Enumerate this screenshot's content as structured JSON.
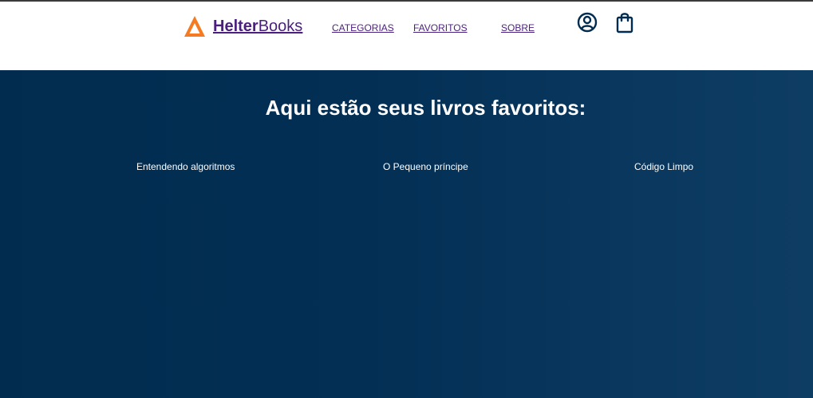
{
  "brand": {
    "name_bold": "Helter",
    "name_regular": "Books",
    "icon": "orange-triangle-logo-icon",
    "color": "#4b1f7f",
    "logo_color": "#f47b22"
  },
  "nav": {
    "items": [
      {
        "label": "CATEGORIAS"
      },
      {
        "label": "FAVORITOS"
      },
      {
        "label": "SOBRE"
      }
    ]
  },
  "header_icons": [
    {
      "icon": "user-icon"
    },
    {
      "icon": "shopping-bag-icon"
    }
  ],
  "favorites": {
    "title": "Aqui estão seus livros favoritos:",
    "books": [
      {
        "title": "Entendendo algoritmos"
      },
      {
        "title": "O Pequeno príncipe"
      },
      {
        "title": "Código Limpo"
      }
    ]
  },
  "colors": {
    "background_start": "#022c4f",
    "background_end": "#0e3d63",
    "text_on_dark": "#ffffff",
    "icon_color": "#022c4f"
  }
}
